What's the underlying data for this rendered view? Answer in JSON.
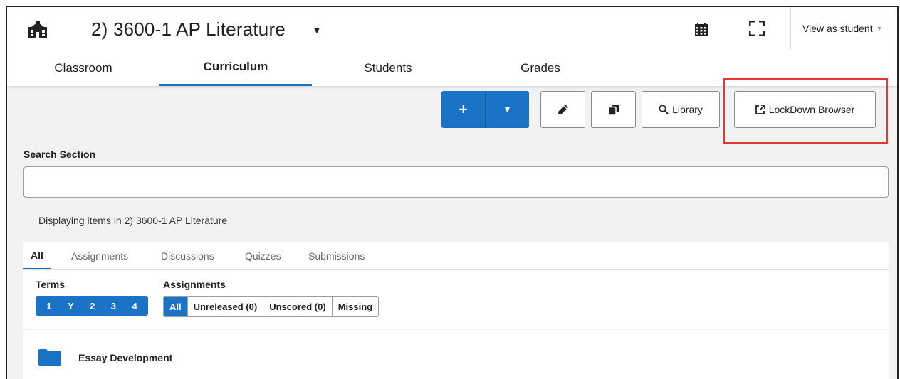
{
  "header": {
    "course_title": "2) 3600-1 AP Literature",
    "view_as_label": "View as student"
  },
  "tabs": [
    {
      "label": "Classroom"
    },
    {
      "label": "Curriculum"
    },
    {
      "label": "Students"
    },
    {
      "label": "Grades"
    }
  ],
  "toolbar": {
    "add_label": "+",
    "library_label": "Library",
    "lockdown_label": "LockDown Browser"
  },
  "search": {
    "label": "Search Section",
    "value": "",
    "placeholder": ""
  },
  "display_text": "Displaying items in 2) 3600-1 AP Literature",
  "filter_tabs": [
    {
      "label": "All"
    },
    {
      "label": "Assignments"
    },
    {
      "label": "Discussions"
    },
    {
      "label": "Quizzes"
    },
    {
      "label": "Submissions"
    }
  ],
  "filters": {
    "terms_label": "Terms",
    "terms": [
      "1",
      "Y",
      "2",
      "3",
      "4"
    ],
    "assignments_label": "Assignments",
    "assignment_options": [
      "All",
      "Unreleased (0)",
      "Unscored (0)",
      "Missing"
    ]
  },
  "items": [
    {
      "title": "Essay Development"
    }
  ],
  "colors": {
    "accent": "#1a73c6",
    "highlight": "#e53935"
  }
}
